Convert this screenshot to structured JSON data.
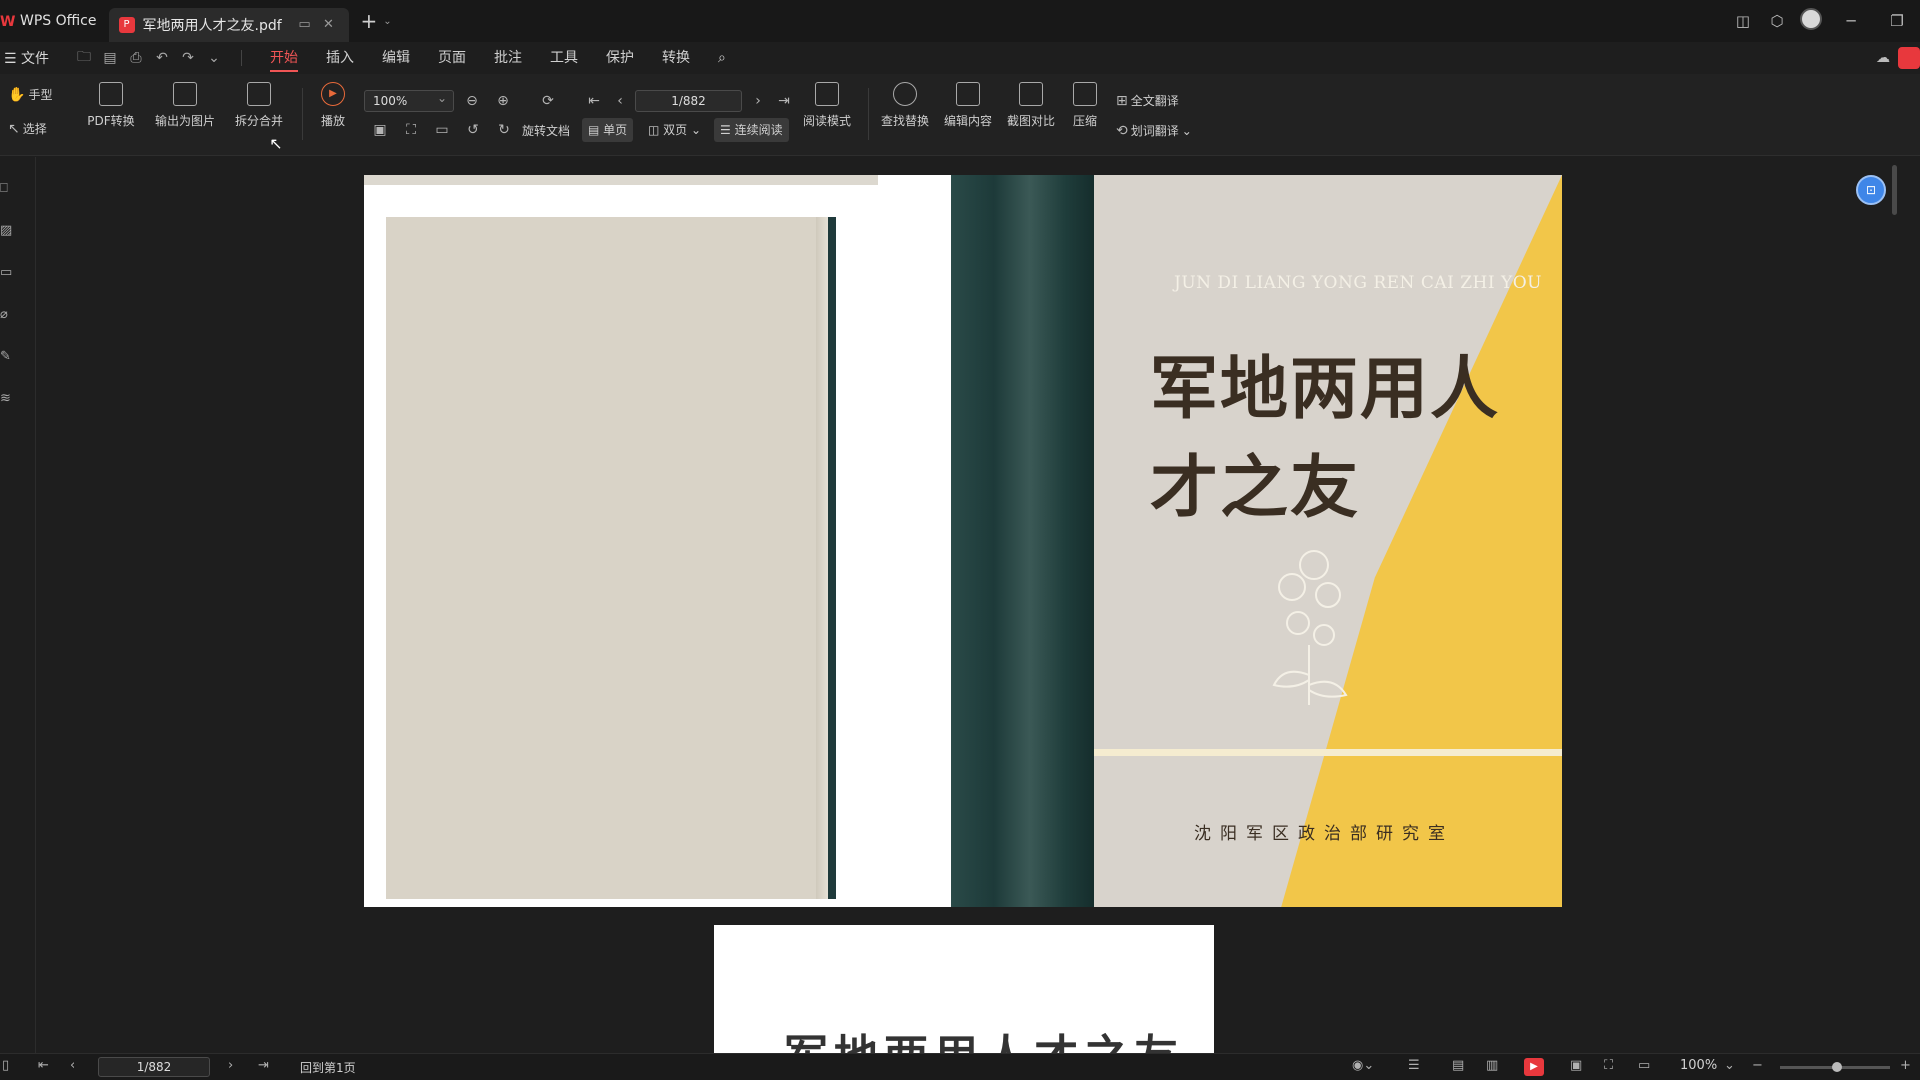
{
  "titlebar": {
    "app_name": "WPS Office",
    "doc_tab": "军地两用人才之友.pdf"
  },
  "menubar": {
    "file": "文件",
    "items": [
      "开始",
      "插入",
      "编辑",
      "页面",
      "批注",
      "工具",
      "保护",
      "转换"
    ],
    "active_index": 0
  },
  "toolbar": {
    "hand": "手型",
    "select": "选择",
    "pdf_convert": "PDF转换",
    "export_image": "输出为图片",
    "split_merge": "拆分合并",
    "play": "播放",
    "zoom_value": "100%",
    "rotate_doc": "旋转文档",
    "page_value": "1/882",
    "single_page": "单页",
    "double_page": "双页",
    "continuous": "连续阅读",
    "read_mode": "阅读模式",
    "find_replace": "查找替换",
    "edit_content": "编辑内容",
    "screenshot_compare": "截图对比",
    "compress": "压缩",
    "full_translate": "全文翻译",
    "word_translate": "划词翻译"
  },
  "document": {
    "cover_pinyin": "JUN DI LIANG YONG REN CAI ZHI YOU",
    "cover_title": "军地两用人才之友",
    "cover_publisher": "沈阳军区政治部研究室",
    "page2_title": "军地两用人才之友"
  },
  "statusbar": {
    "page_value": "1/882",
    "back_to_first": "回到第1页",
    "zoom_value": "100%"
  },
  "colors": {
    "accent": "#f05555",
    "cover_yellow": "#f2c649",
    "spine_green": "#1d3a39",
    "float_button": "#3f86e8"
  }
}
